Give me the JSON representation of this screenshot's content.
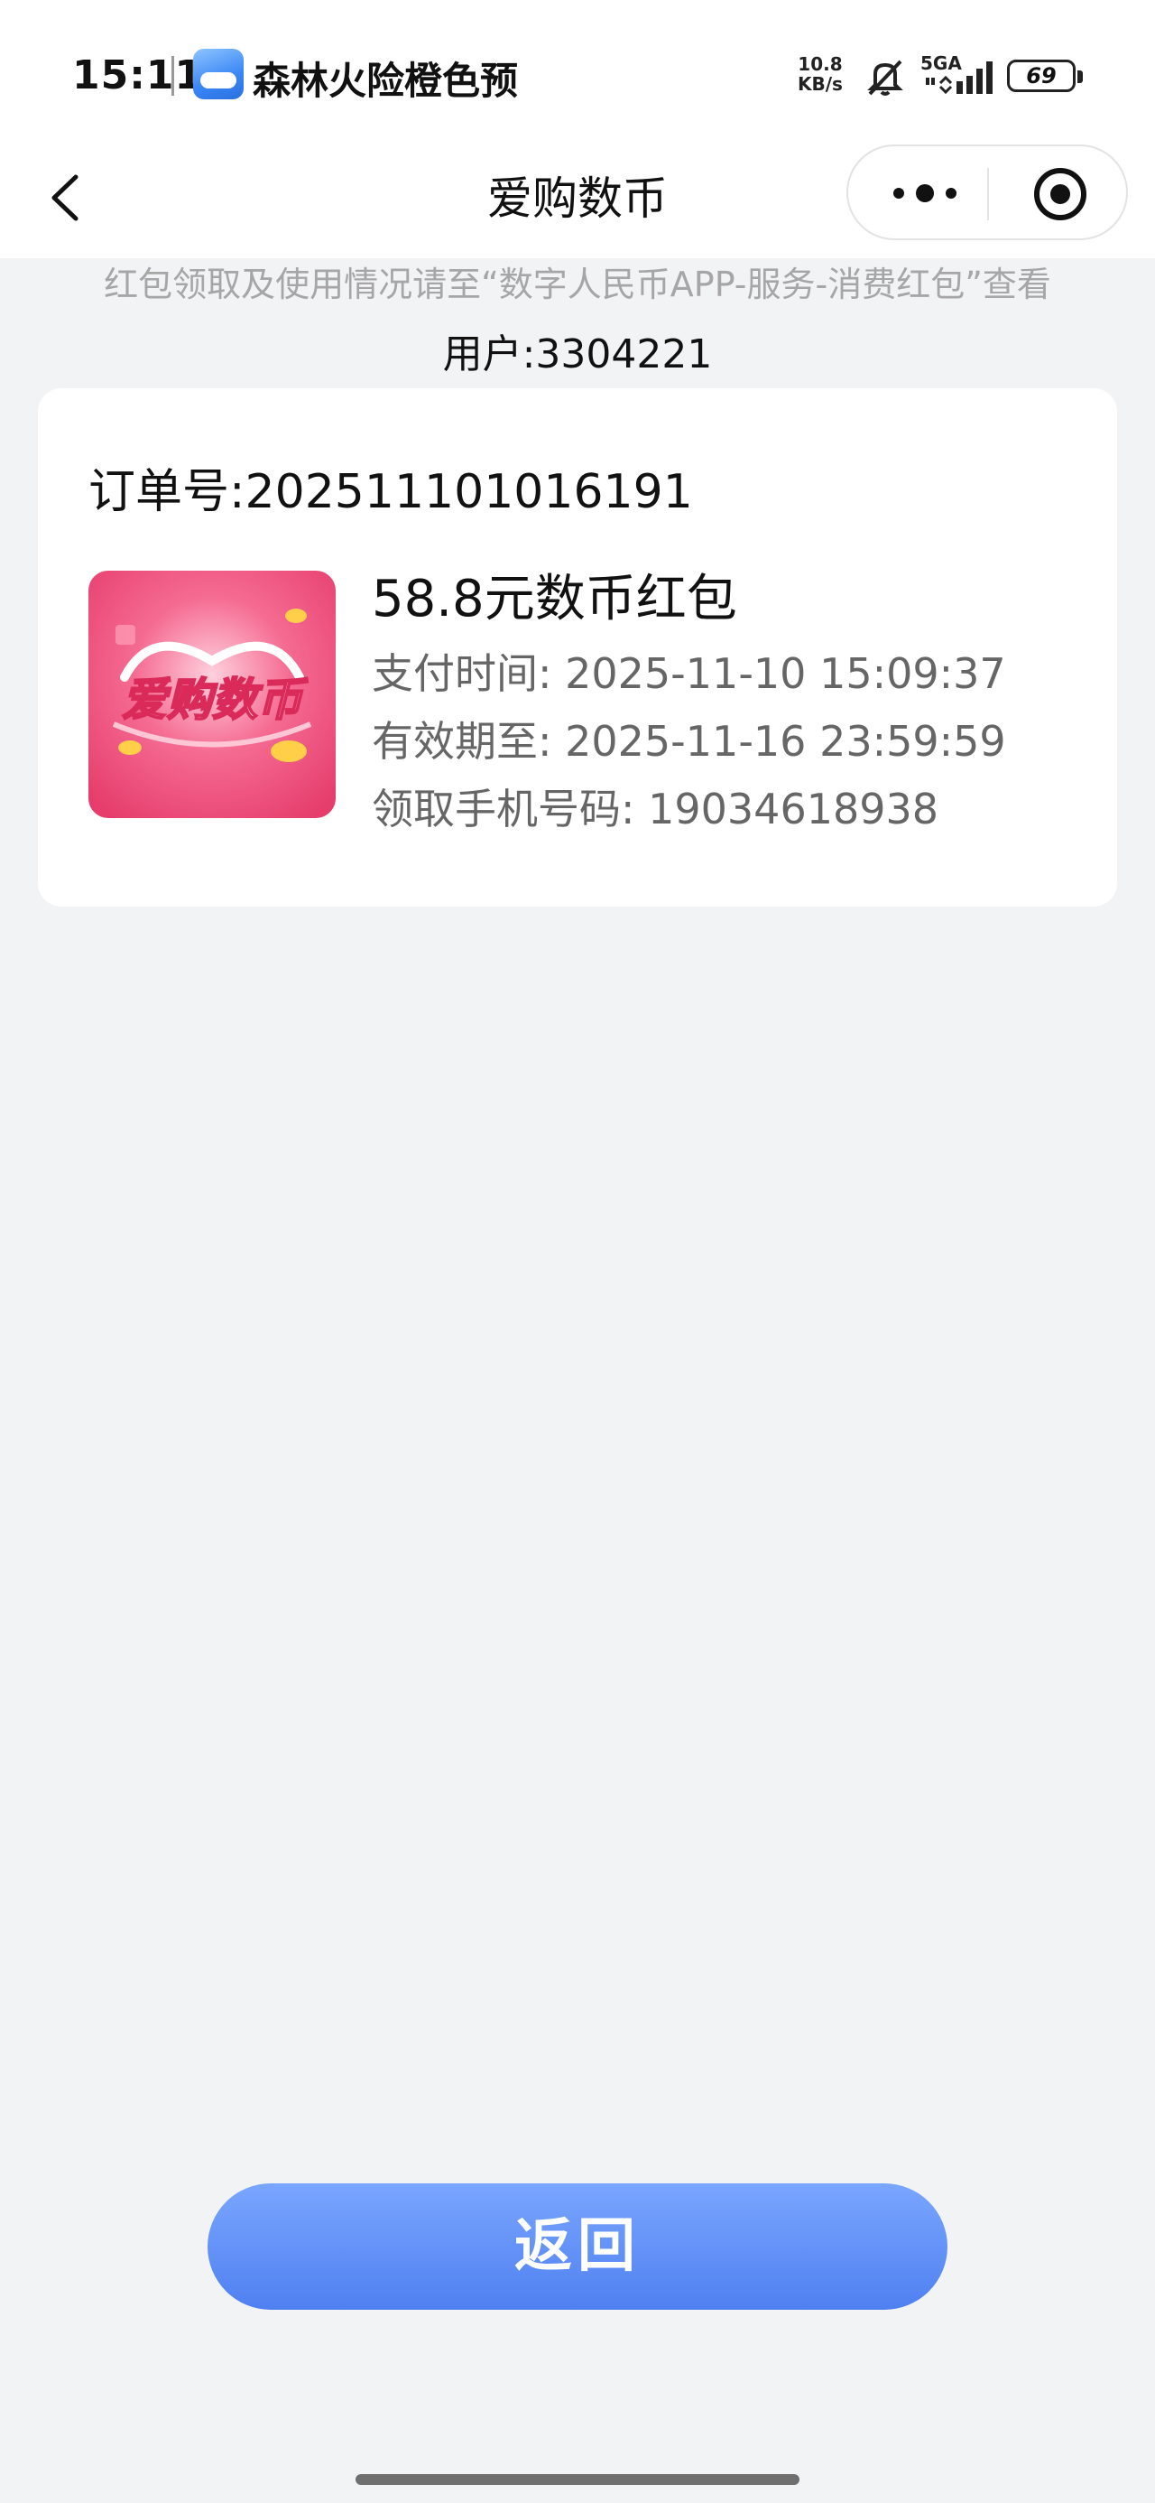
{
  "status_bar": {
    "time": "15:11",
    "app_name": "森林火险橙色预",
    "net_speed_value": "10.8",
    "net_speed_unit": "KB/s",
    "signal_label": "5GA",
    "battery": "69",
    "icons": [
      "app-icon",
      "mute-icon",
      "signal-icon",
      "battery-icon"
    ]
  },
  "nav": {
    "title": "爱购数币",
    "back_icon": "chevron-left-icon",
    "more_icon": "more-dots-icon",
    "close_icon": "target-circle-icon"
  },
  "notice": "红包领取及使用情况请至“数字人民币APP-服务-消费红包”查看",
  "user_line": "用户:3304221",
  "order": {
    "order_no": "订单号:202511101016191",
    "image_text": "爱购数币",
    "title": "58.8元数币红包",
    "pay_time": "支付时间: 2025-11-10 15:09:37",
    "valid_until": "有效期至: 2025-11-16 23:59:59",
    "phone": "领取手机号码: 19034618938"
  },
  "return_button": "返回",
  "colors": {
    "background": "#f2f3f5",
    "button_top": "#7aa6ff",
    "button_bottom": "#4f80f0",
    "image_pink": "#ee4a78",
    "notice_gray": "#a6a6a6"
  }
}
